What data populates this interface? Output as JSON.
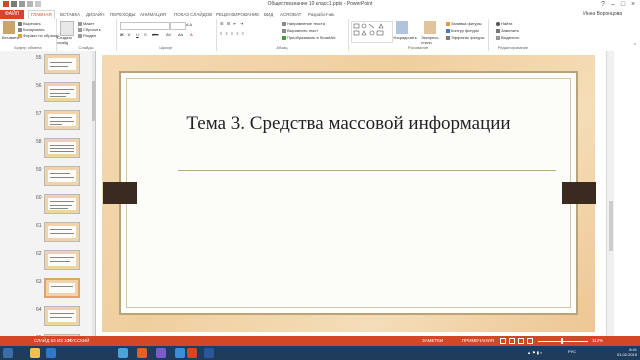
{
  "app": {
    "title": "Обществознание 10 класс1.pptx - PowerPoint",
    "user": "Инна Воронцова"
  },
  "ribbon_tabs": [
    {
      "label": "ФАЙЛ"
    },
    {
      "label": "ГЛАВНАЯ"
    },
    {
      "label": "ВСТАВКА"
    },
    {
      "label": "ДИЗАЙН"
    },
    {
      "label": "ПЕРЕХОДЫ"
    },
    {
      "label": "АНИМАЦИЯ"
    },
    {
      "label": "ПОКАЗ СЛАЙДОВ"
    },
    {
      "label": "РЕЦЕНЗИРОВАНИЕ"
    },
    {
      "label": "ВИД"
    },
    {
      "label": "ACROBAT"
    },
    {
      "label": "Разработчик"
    }
  ],
  "ribbon": {
    "clipboard": {
      "paste": "Вставить",
      "cut": "Вырезать",
      "copy": "Копировать",
      "format": "Формат по образцу",
      "label": "Буфер обмена"
    },
    "slides": {
      "new": "Создать слайд",
      "layout": "Макет",
      "reset": "Сбросить",
      "section": "Раздел",
      "label": "Слайды"
    },
    "font": {
      "label": "Шрифт"
    },
    "paragraph": {
      "direction": "Направление текста",
      "align": "Выровнять текст",
      "smartart": "Преобразовать в SmartArt",
      "label": "Абзац"
    },
    "drawing": {
      "arrange": "Упорядочить",
      "styles": "Экспресс-стили",
      "fill": "Заливка фигуры",
      "outline": "Контур фигуры",
      "effects": "Эффекты фигуры",
      "label": "Рисование"
    },
    "editing": {
      "find": "Найти",
      "replace": "Заменить",
      "select": "Выделить",
      "label": "Редактирование"
    }
  },
  "thumbnails": [
    {
      "num": "55"
    },
    {
      "num": "56"
    },
    {
      "num": "57"
    },
    {
      "num": "58"
    },
    {
      "num": "59"
    },
    {
      "num": "60"
    },
    {
      "num": "61"
    },
    {
      "num": "62"
    },
    {
      "num": "63"
    },
    {
      "num": "64"
    },
    {
      "num": "65"
    }
  ],
  "slide": {
    "title": "Тема 3. Средства массовой информации"
  },
  "status": {
    "slide_count": "СЛАЙД 63 ИЗ 104",
    "language": "РУССКИЙ",
    "notes": "ЗАМЕТКИ",
    "comments": "ПРИМЕЧАНИЯ",
    "zoom": "112%",
    "zoom_fraction": 0.48
  },
  "taskbar": {
    "time": "8:41",
    "date": "01.02.2019",
    "lang": "РУС"
  },
  "colors": {
    "accent": "#d24726",
    "taskbar": "#1f3c5c",
    "slide_bg": "#f0cf9e",
    "frame": "#b9a37a"
  }
}
